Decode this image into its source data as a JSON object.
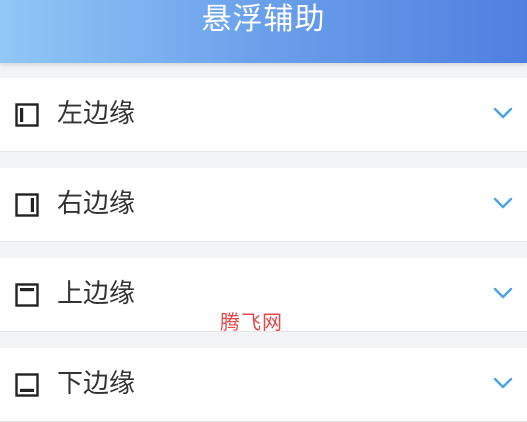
{
  "header": {
    "title": "悬浮辅助"
  },
  "rows": [
    {
      "label": "左边缘",
      "icon": "panel-left-icon"
    },
    {
      "label": "右边缘",
      "icon": "panel-right-icon"
    },
    {
      "label": "上边缘",
      "icon": "panel-top-icon"
    },
    {
      "label": "下边缘",
      "icon": "panel-bottom-icon"
    }
  ],
  "watermark": {
    "text": "腾飞网"
  },
  "colors": {
    "header_start": "#8fc7f5",
    "header_end": "#4f7fe0",
    "chevron": "#4aa3e8",
    "watermark": "#e0484a"
  }
}
